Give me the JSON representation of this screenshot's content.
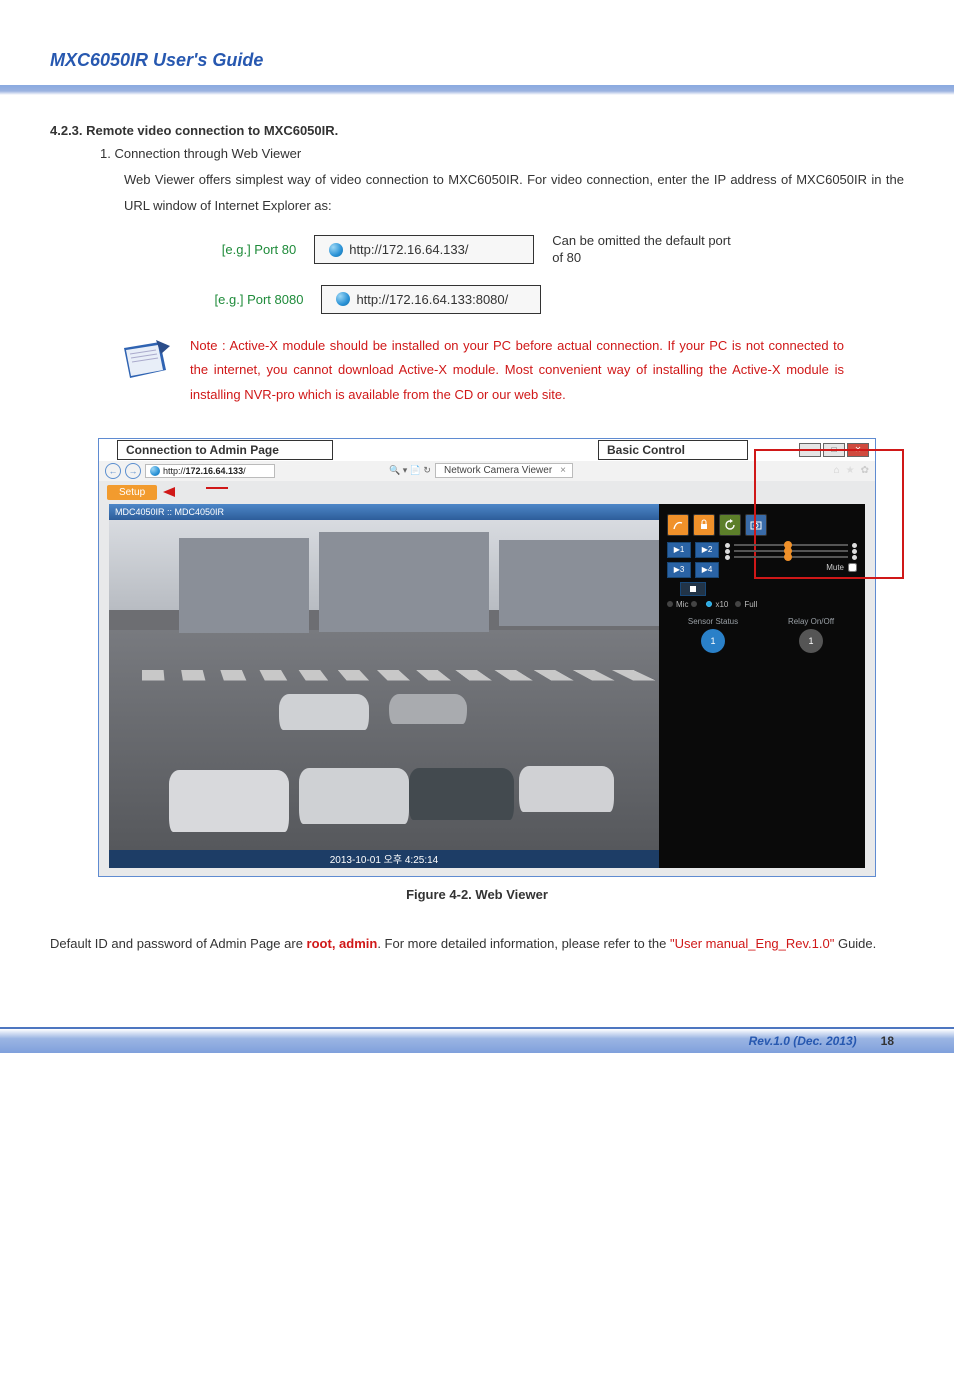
{
  "header": {
    "title": "MXC6050IR User's Guide"
  },
  "section": {
    "heading": "4.2.3. Remote video connection to MXC6050IR.",
    "list_item": "1.   Connection through Web Viewer",
    "paragraph": "Web Viewer offers simplest way of video connection to MXC6050IR. For video connection, enter the IP address of MXC6050IR in the URL window of Internet Explorer as:"
  },
  "examples": {
    "row1": {
      "label": "[e.g.] Port 80",
      "url": "http://172.16.64.133/",
      "note": "Can be omitted the default port of 80"
    },
    "row2": {
      "label": "[e.g.] Port 8080",
      "url": "http://172.16.64.133:8080/",
      "note": ""
    }
  },
  "note": {
    "text": "Note : Active-X module should be installed on your PC before actual connection. If your PC is not connected to the internet, you cannot download Active-X module. Most convenient way of installing the Active-X module is installing NVR-pro which is available from the CD or our web site."
  },
  "figure": {
    "label_admin": "Connection to Admin Page",
    "label_control": "Basic Control",
    "browser_url_prefix": "http://",
    "browser_url_host": "172.16.64.133",
    "browser_url_suffix": "/",
    "search_icons_text": "🔍 ▾ 📄 ↻",
    "tab_title": "Network Camera Viewer",
    "setup_label": "Setup",
    "title_bar": "MDC4050IR :: MDC4050IR",
    "timestamp": "2013-10-01 오후 4:25:14",
    "panel": {
      "presets": [
        "▶1",
        "▶2",
        "▶3",
        "▶4"
      ],
      "mute_label": "Mute",
      "mic_label": "Mic",
      "x10_label": "x10",
      "full_label": "Full",
      "sensor_label": "Sensor Status",
      "relay_label": "Relay On/Off",
      "sensor_value": "1",
      "relay_value": "1"
    },
    "caption": "Figure 4-2. Web Viewer"
  },
  "footer_para": {
    "pre": "Default ID and password of Admin Page are ",
    "credentials": "root, admin",
    "mid": ". For more detailed information, please refer to the ",
    "link": "\"User manual_Eng_Rev.1.0\"",
    "post": " Guide."
  },
  "page_footer": {
    "rev": "Rev.1.0 (Dec. 2013)",
    "page": "18"
  }
}
